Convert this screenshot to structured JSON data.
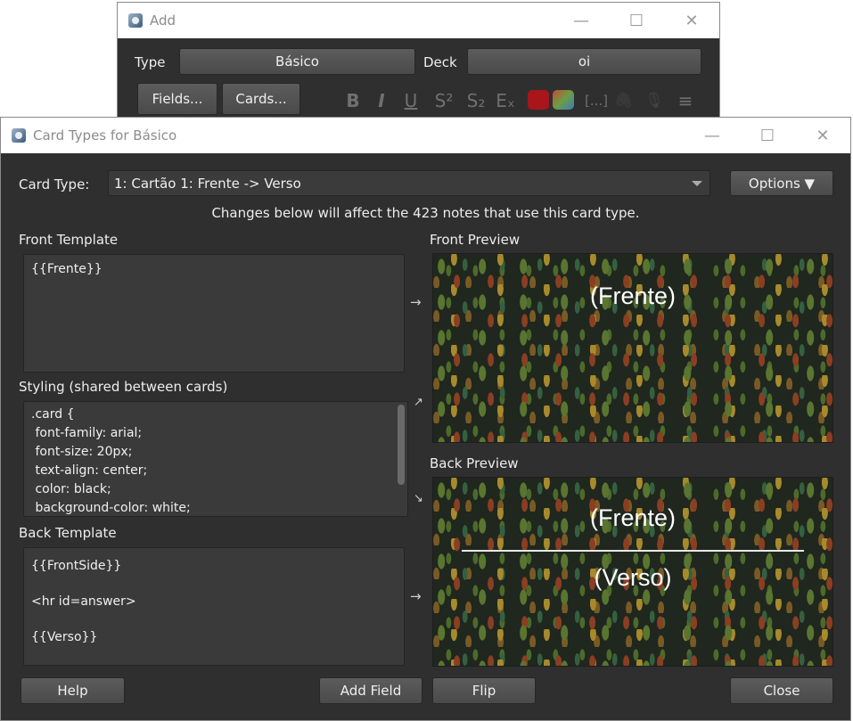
{
  "add_window": {
    "title": "Add",
    "type_label": "Type",
    "type_value": "Básico",
    "deck_label": "Deck",
    "deck_value": "oi",
    "fields_button": "Fields...",
    "cards_button": "Cards...",
    "toolbar": {
      "bold": "B",
      "italic": "I",
      "underline": "U",
      "superscript": "S²",
      "subscript": "S₂",
      "clear_format": "Eₓ",
      "cloze": "[...]",
      "attach": "🖇",
      "record": "🎙",
      "menu": "≡"
    },
    "colors": {
      "text_color": "#c0161b"
    }
  },
  "card_window": {
    "title": "Card Types for Básico",
    "card_type_label": "Card Type:",
    "card_type_value": "1: Cartão 1: Frente -> Verso",
    "options_button": "Options ▼",
    "notice": "Changes below will affect the 423 notes that use this card type.",
    "front_template_label": "Front Template",
    "front_template_text": "{{Frente}}",
    "styling_label": "Styling (shared between cards)",
    "styling_text": ".card {\n font-family: arial;\n font-size: 20px;\n text-align: center;\n color: black;\n background-color: white;",
    "back_template_label": "Back Template",
    "back_template_text": "{{FrontSide}}\n\n<hr id=answer>\n\n{{Verso}}",
    "front_preview_label": "Front Preview",
    "front_preview_text": "(Frente)",
    "back_preview_label": "Back Preview",
    "back_preview_front": "(Frente)",
    "back_preview_back": "(Verso)",
    "help_button": "Help",
    "add_field_button": "Add Field",
    "flip_button": "Flip",
    "close_button": "Close",
    "arrows": {
      "front": "→",
      "styling_front": "↗",
      "styling_back": "↘",
      "back": "→"
    }
  },
  "window_controls": {
    "minimize": "—",
    "maximize": "☐",
    "close": "✕"
  }
}
